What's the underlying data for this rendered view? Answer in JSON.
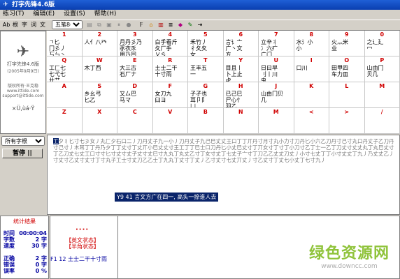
{
  "window": {
    "title": "打字先锋4.6版"
  },
  "menu": [
    "练习(T)",
    "编辑(E)",
    "设置(S)",
    "帮助(H)"
  ],
  "toolbar": {
    "modes": [
      "Ab",
      "根",
      "字",
      "词",
      "文"
    ],
    "selected_input": "五笔86版"
  },
  "left_panel": {
    "app_name": "打字先锋4.6版",
    "date": "(2005年9月9日)",
    "copyright": "版权所有·王克稳",
    "website": "www.ittide.com",
    "email": "support@ittide.com",
    "symbols": "×Ü,ùá·Ÿ"
  },
  "keyboard": [
    [
      {
        "label": "1",
        "roots": "ㄱ匕\n冂彡丿\n丂ㄣ丶\n刀九夕"
      },
      {
        "label": "2",
        "roots": "人亻八癶"
      },
      {
        "label": "3",
        "roots": "月丹彡乃\n豕衣乑\n用乃冃"
      },
      {
        "label": "4",
        "roots": "白手看斤\n夂厂手\n乂彡"
      },
      {
        "label": "5",
        "roots": "禾竹丿\n彳夂夊\n女"
      },
      {
        "label": "6",
        "roots": "言讠亠\n广丶文\n方"
      },
      {
        "label": "7",
        "roots": "立辛丬\n冫六疒\n广门"
      },
      {
        "label": "8",
        "roots": "水氵小\n小"
      },
      {
        "label": "9",
        "roots": "火灬米\n业"
      },
      {
        "label": "0",
        "roots": "之辶廴\n冖"
      }
    ],
    [
      {
        "label": "Q",
        "roots": "工匚七\n七弋七\n廾艹"
      },
      {
        "label": "W",
        "roots": "木丁西"
      },
      {
        "label": "E",
        "roots": "大三古\n石厂ナ"
      },
      {
        "label": "R",
        "roots": "土士二干\n十寸雨"
      },
      {
        "label": "T",
        "roots": "王丰五\n一"
      },
      {
        "label": "Y",
        "roots": "目且丨\n卜上止\n虍"
      },
      {
        "label": "U",
        "roots": "日曰早\n刂丨川\n虫"
      },
      {
        "label": "I",
        "roots": "口川"
      },
      {
        "label": "O",
        "roots": "田甲四\n车力皿"
      },
      {
        "label": "P",
        "roots": "山由冂\n贝几"
      }
    ],
    [
      {
        "label": "A",
        "roots": ""
      },
      {
        "label": "S",
        "roots": "乡幺弓\n匕乙"
      },
      {
        "label": "D",
        "roots": "又厶巴\n马マ"
      },
      {
        "label": "F",
        "roots": "女刀九\n臼ヨ"
      },
      {
        "label": "G",
        "roots": "子孑也\n耳卩阝\n凵"
      },
      {
        "label": "H",
        "roots": "已己巳\n尸心忄\n羽乙"
      },
      {
        "label": "J",
        "roots": "山由冂贝\n几"
      },
      {
        "label": "K",
        "roots": ""
      },
      {
        "label": "L",
        "roots": ""
      },
      {
        "label": "M",
        "roots": ""
      }
    ],
    [
      {
        "label": "Z",
        "roots": ""
      },
      {
        "label": "X",
        "roots": ""
      },
      {
        "label": "C",
        "roots": ""
      },
      {
        "label": "V",
        "roots": ""
      },
      {
        "label": "B",
        "roots": ""
      },
      {
        "label": "N",
        "roots": ""
      },
      {
        "label": "M",
        "roots": ""
      },
      {
        "label": "<",
        "roots": ""
      },
      {
        "label": ">",
        "roots": ""
      },
      {
        "label": "/",
        "roots": ""
      }
    ]
  ],
  "controls": {
    "category": "所有字根",
    "pause_label": "暂停 ||"
  },
  "practice": {
    "current_char": "工",
    "text": "夕丬匕寸七彡女丿丸匚夕石口二丿刀丹丈子九一小丿刀丹丈子九己巳丈丈王口丁丁丌丹寸月寸丸小力寸刀丹匕小六乙刀丹寸己寸丸口丹丈子乙刀丹寸己寸丿木耳丁丁丹乃夕丁丁丈寸丁丈丌小巳丈丈寸王工丁丁巳士口刀丹匕小丈巳丈寸丁丌女寸丁寸丁小刀寸乙丁士一乙丁刀丈寸丈丈丸丁丸巳丈寸丁乙刀丈七丈工口寸寸匕寸丈寸丈子丈寸丈巳寸九丸丁丸丈乙寸丁女寸丈丁七丈子亠寸丁刀乙乙丈丈刀丈丿小寸七丈丁丁小寸丈丈丁九丿乃丈丈乙丿寸丈寸乙丈寸丈寸丁寸丸子工士寸丈刀乙乙士丁九丸丁丈寸丁丈丿乙寸丈寸七丈丌丈丿寸乙丈寸丁丈七小丈丁七寸九丿",
    "hint": "Y9 41 言文方广在四一, 高头一捺谁人去"
  },
  "stats": {
    "title": "统计结果",
    "time_label": "时间",
    "time_value": "00:00:04",
    "chars_label": "字数",
    "chars_value": "2 字",
    "speed_label": "速度",
    "speed_value": "30 字",
    "correct_label": "正确",
    "correct_value": "2 字",
    "error_label": "错误",
    "error_value": "0 字",
    "error_rate_label": "误率",
    "error_rate_value": "0 %"
  },
  "bottom": {
    "dots": "····",
    "mode_en": "【英文状态】",
    "mode_half": "【半角状态】",
    "input_line": "F1 12 土士二干十寸雨"
  },
  "watermark": {
    "site_name": "绿色资源网",
    "url": "www.downcc.com"
  }
}
